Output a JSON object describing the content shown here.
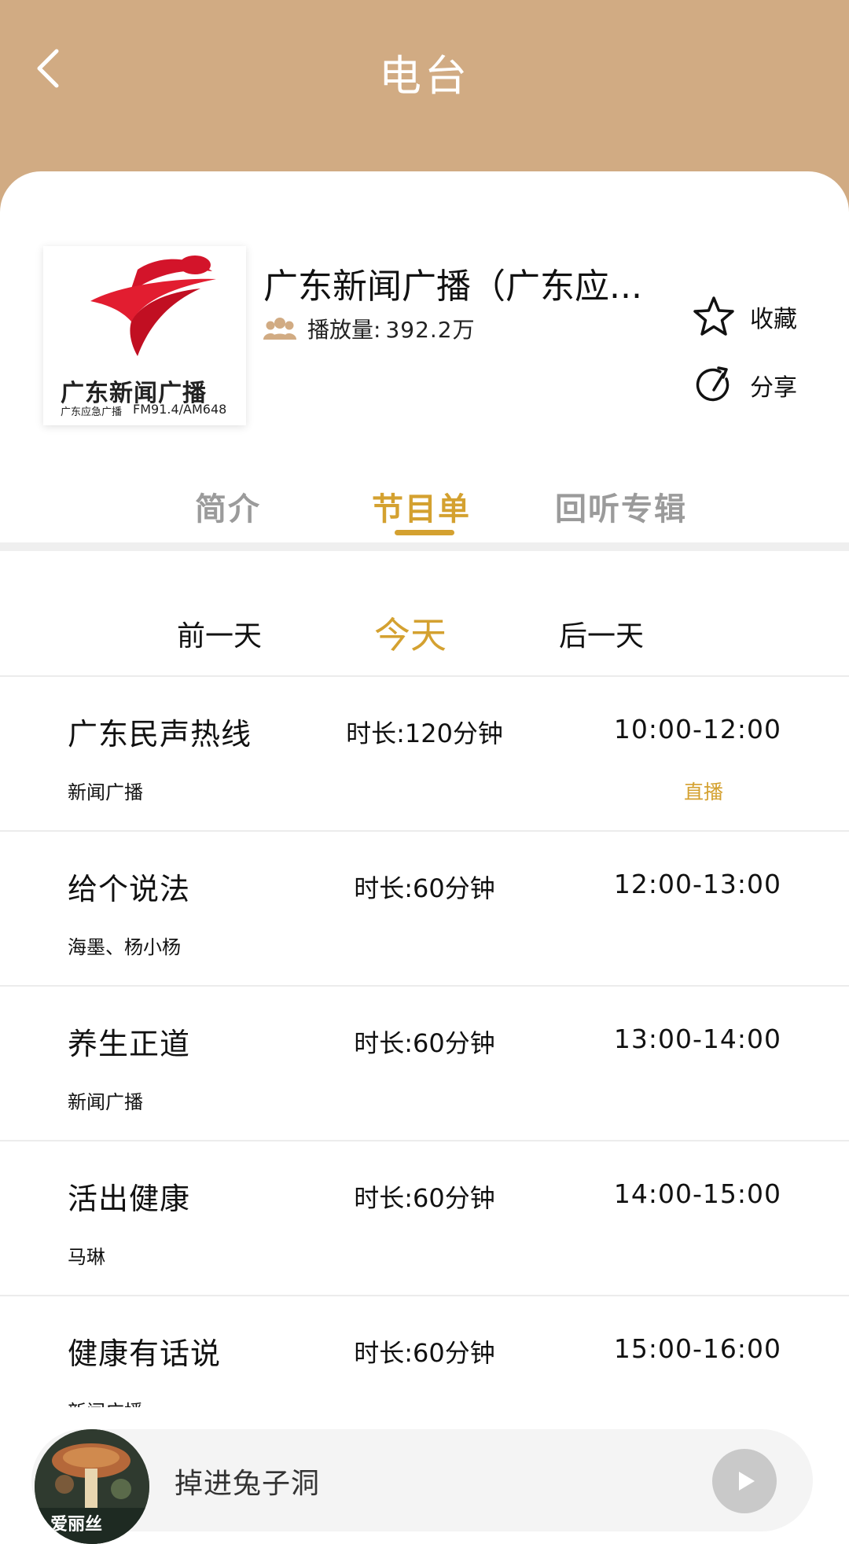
{
  "header": {
    "title": "电台"
  },
  "station": {
    "name": "广东新闻广播（广东应...",
    "plays_label": "播放量:",
    "plays_value": "392.2万",
    "logo_main": "广东新闻广播",
    "logo_sub": "广东应急广播",
    "logo_freq": "FM91.4/AM648"
  },
  "actions": {
    "favorite": "收藏",
    "share": "分享"
  },
  "tabs": [
    {
      "label": "简介",
      "active": false
    },
    {
      "label": "节目单",
      "active": true
    },
    {
      "label": "回听专辑",
      "active": false
    }
  ],
  "days": [
    {
      "label": "前一天",
      "active": false
    },
    {
      "label": "今天",
      "active": true
    },
    {
      "label": "后一天",
      "active": false
    }
  ],
  "programs": [
    {
      "name": "广东民声热线",
      "duration": "时长:120分钟",
      "time": "10:00-12:00",
      "host": "新闻广播",
      "status": "直播"
    },
    {
      "name": "给个说法",
      "duration": "时长:60分钟",
      "time": "12:00-13:00",
      "host": "海墨、杨小杨",
      "status": ""
    },
    {
      "name": "养生正道",
      "duration": "时长:60分钟",
      "time": "13:00-14:00",
      "host": "新闻广播",
      "status": ""
    },
    {
      "name": "活出健康",
      "duration": "时长:60分钟",
      "time": "14:00-15:00",
      "host": "马琳",
      "status": ""
    },
    {
      "name": "健康有话说",
      "duration": "时长:60分钟",
      "time": "15:00-16:00",
      "host": "新闻广播",
      "status": ""
    }
  ],
  "player": {
    "title": "掉进兔子洞",
    "cover_text": "爱丽丝"
  },
  "colors": {
    "header_bg": "#d1ab83",
    "accent": "#d4a130"
  }
}
